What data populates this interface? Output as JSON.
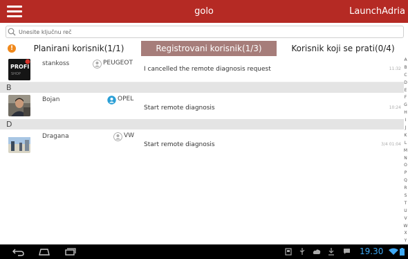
{
  "topbar": {
    "app_title": "golo",
    "user_title": "LaunchAdria"
  },
  "search": {
    "placeholder": "Unesite ključnu reč"
  },
  "tabs": [
    {
      "label": "Planirani korisnik(1/1)",
      "active": false,
      "badge": "!"
    },
    {
      "label": "Registrovani korisnik(1/3)",
      "active": true
    },
    {
      "label": "Korisnik koji se prati(0/4)",
      "active": false
    }
  ],
  "sections": [
    {
      "letter": "B"
    },
    {
      "letter": "D"
    }
  ],
  "contacts": [
    {
      "name": "stankoss",
      "brand": "PEUGEOT",
      "message": "I cancelled the remote diagnosis request",
      "time": "11:32",
      "avatar_text": "PROFI",
      "avatar_badge": ""
    },
    {
      "name": "Bojan",
      "brand": "OPEL",
      "message": "Start remote diagnosis",
      "time": "10:24"
    },
    {
      "name": "Dragana",
      "brand": "VW",
      "message": "Start remote diagnosis",
      "time": "3/4 01:04"
    }
  ],
  "alphabet": [
    "A",
    "B",
    "C",
    "D",
    "E",
    "F",
    "G",
    "H",
    "I",
    "J",
    "K",
    "L",
    "M",
    "N",
    "O",
    "P",
    "Q",
    "R",
    "S",
    "T",
    "U",
    "V",
    "W",
    "X",
    "Y",
    "Z",
    "#"
  ],
  "statusbar": {
    "clock": "19.30"
  },
  "colors": {
    "accent": "#b52a24",
    "active_tab": "#a67d7a",
    "clock": "#3fa9f5",
    "badge": "#f0891c",
    "online": "#2a9fd6"
  }
}
